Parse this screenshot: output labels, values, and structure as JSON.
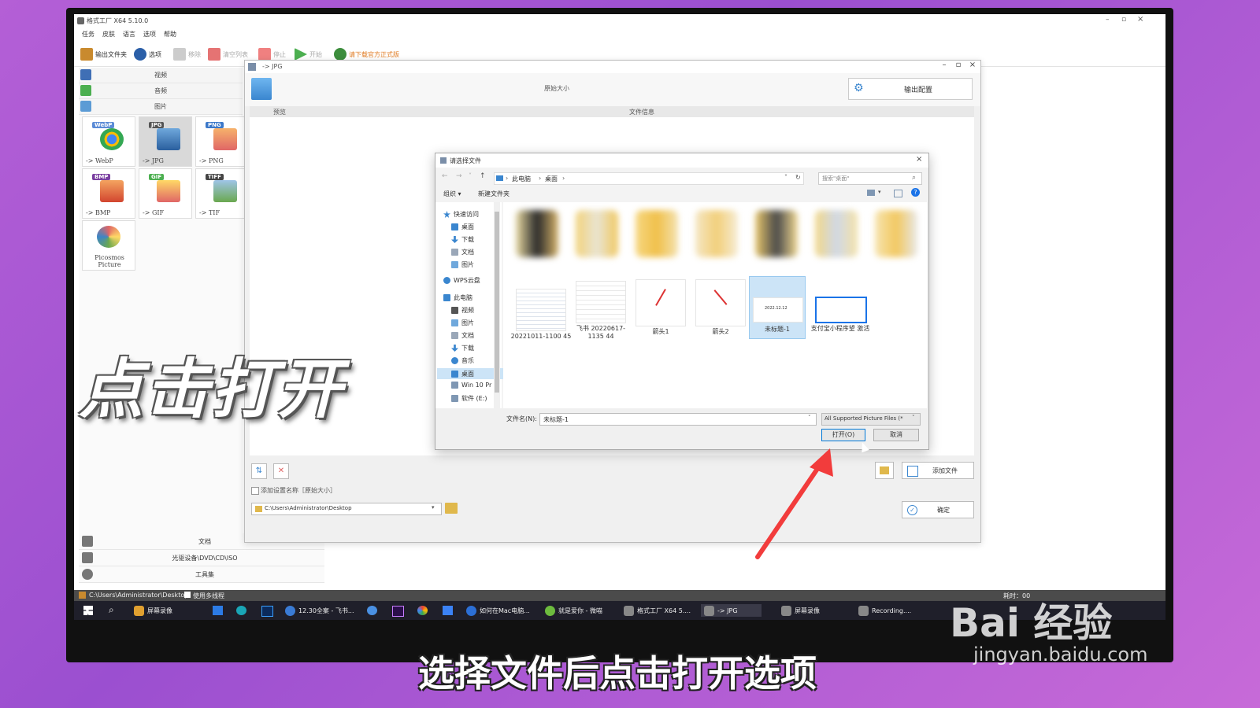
{
  "app": {
    "title": "格式工厂 X64 5.10.0",
    "menu": [
      "任务",
      "皮肤",
      "语言",
      "选项",
      "帮助"
    ],
    "toolbar": {
      "output_folder": "输出文件夹",
      "options": "选项",
      "remove": "移除",
      "clear_list": "清空列表",
      "stop": "停止",
      "start": "开始",
      "download_notice": "请下载官方正式版"
    },
    "categories": {
      "video": "视频",
      "audio": "音频",
      "image": "图片"
    },
    "formats": [
      {
        "badge": "WebP",
        "name": "-> WebP",
        "color": "#5b8bd6"
      },
      {
        "badge": "JPG",
        "name": "-> JPG",
        "color": "#555"
      },
      {
        "badge": "PNG",
        "name": "-> PNG",
        "color": "#3b78c9"
      },
      {
        "badge": "BMP",
        "name": "-> BMP",
        "color": "#7a3fa0"
      },
      {
        "badge": "GIF",
        "name": "-> GIF",
        "color": "#4caf50"
      },
      {
        "badge": "TIFF",
        "name": "-> TIF",
        "color": "#444"
      }
    ],
    "picosmos": "Picosmos Picture",
    "bottom_categories": {
      "document": "文档",
      "disc": "光驱设备\\DVD\\CD\\ISO",
      "toolset": "工具集"
    },
    "status_path": "C:\\Users\\Administrator\\Desktop",
    "multithread": "使用多线程",
    "status_right": "耗时：00"
  },
  "jpg_dialog": {
    "title": "-> JPG",
    "size_label": "原始大小",
    "output_config": "输出配置",
    "col_preview": "预览",
    "col_fileinfo": "文件信息",
    "add_setting_label": "添加设置名称［原始大小］",
    "output_path": "C:\\Users\\Administrator\\Desktop",
    "add_file": "添加文件",
    "ok": "确定"
  },
  "file_dialog": {
    "title": "请选择文件",
    "breadcrumb": [
      "此电脑",
      "桌面"
    ],
    "search_placeholder": "搜索\"桌面\"",
    "organize": "组织 ▾",
    "new_folder": "新建文件夹",
    "nav": {
      "quick_access": "快速访问",
      "desktop": "桌面",
      "downloads": "下载",
      "documents": "文档",
      "pictures": "图片",
      "wps": "WPS云盘",
      "this_pc": "此电脑",
      "videos": "视频",
      "pictures2": "图片",
      "documents2": "文档",
      "downloads2": "下载",
      "music": "音乐",
      "desktop2": "桌面",
      "win10": "Win 10 Pr",
      "software": "软件 (E:)"
    },
    "files": [
      {
        "name": "20221011-1100 45"
      },
      {
        "name": "飞书 20220617-1135 44"
      },
      {
        "name": "箭头1"
      },
      {
        "name": "箭头2"
      },
      {
        "name": "未标题-1"
      },
      {
        "name": "支付宝小程序望 激活"
      }
    ],
    "selected_thumb_text": "2022.12.12",
    "filename_label": "文件名(N):",
    "filename_value": "未标题-1",
    "filetype": "All Supported Picture Files (*",
    "open": "打开(O)",
    "cancel": "取消"
  },
  "taskbar": [
    {
      "label": "屏幕录像",
      "color": "#e0a030"
    },
    {
      "label": "12.30全案 - 飞书...",
      "color": "#3a7bd5"
    },
    {
      "label": "如何在Mac电脑...",
      "color": "#2c6fd6"
    },
    {
      "label": "就是爱你 - 微喵",
      "color": "#6dbb3e"
    },
    {
      "label": "格式工厂 X64 5....",
      "color": "#888"
    },
    {
      "label": "-> JPG",
      "color": "#888"
    },
    {
      "label": "屏幕录像",
      "color": "#888"
    },
    {
      "label": "Recording....",
      "color": "#888"
    }
  ],
  "overlay": {
    "instruction": "点击打开",
    "subtitle": "选择文件后点击打开选项"
  },
  "watermark": {
    "brand": "Bai 经验",
    "site": "jingyan.baidu.com"
  }
}
